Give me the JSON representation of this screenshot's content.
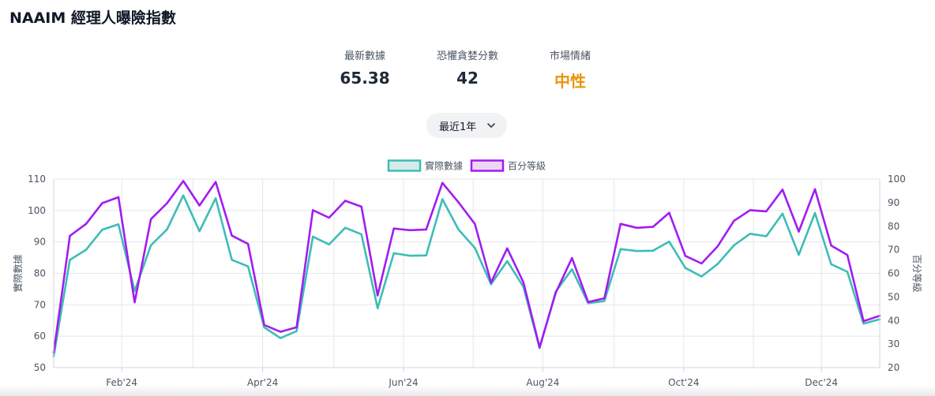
{
  "page": {
    "title": "NAAIM 經理人曝險指數"
  },
  "stats": [
    {
      "label": "最新數據",
      "value": "65.38",
      "color": "#1f2937"
    },
    {
      "label": "恐懼貪婪分數",
      "value": "42",
      "color": "#1f2937"
    },
    {
      "label": "市場情緒",
      "value": "中性",
      "color": "#e8950b"
    }
  ],
  "range_select": {
    "value": "最近1年",
    "icon": "chevron-down-icon"
  },
  "chart_data": {
    "type": "line",
    "x_ticks": [
      "Feb'24",
      "Apr'24",
      "Jun'24",
      "Aug'24",
      "Oct'24",
      "Dec'24"
    ],
    "yleft": {
      "label": "實際數據",
      "ticks": [
        50,
        60,
        70,
        80,
        90,
        100,
        110
      ],
      "range": [
        50,
        110
      ]
    },
    "yright": {
      "label": "百分等級",
      "ticks": [
        20,
        30,
        40,
        50,
        60,
        70,
        80,
        90,
        100
      ],
      "range": [
        20,
        100
      ]
    },
    "grid": true,
    "legend_position": "top",
    "series": [
      {
        "name": "實際數據",
        "axis": "left",
        "color": "#3dbdb6",
        "values": [
          53.6,
          84.3,
          87.5,
          93.9,
          95.6,
          74.4,
          88.9,
          94.0,
          104.8,
          93.4,
          103.9,
          84.3,
          82.2,
          62.8,
          59.4,
          61.6,
          91.7,
          89.2,
          94.5,
          92.4,
          68.9,
          86.4,
          85.6,
          85.7,
          103.6,
          93.9,
          88.1,
          76.5,
          83.9,
          75.7,
          56.2,
          74.2,
          81.3,
          70.5,
          71.2,
          87.7,
          87.1,
          87.2,
          90.1,
          81.7,
          79.0,
          83.0,
          88.9,
          92.6,
          91.8,
          99.0,
          85.9,
          99.2,
          82.9,
          80.5,
          64.0,
          65.38
        ]
      },
      {
        "name": "百分等級",
        "axis": "right",
        "color": "#a21cf0",
        "values": [
          26.3,
          75.9,
          81.0,
          89.8,
          92.3,
          47.7,
          83.0,
          89.8,
          99.2,
          88.8,
          98.8,
          76.0,
          72.5,
          38.1,
          35.2,
          37.1,
          86.8,
          83.6,
          90.8,
          88.3,
          50.6,
          79.0,
          78.3,
          78.6,
          98.4,
          90.1,
          81.0,
          56.1,
          70.6,
          56.2,
          28.6,
          51.8,
          66.5,
          47.8,
          49.4,
          81.0,
          79.3,
          79.7,
          85.7,
          67.4,
          64.2,
          71.5,
          82.3,
          86.8,
          86.3,
          95.5,
          77.7,
          95.7,
          71.8,
          67.8,
          39.7,
          42.0
        ]
      }
    ]
  }
}
